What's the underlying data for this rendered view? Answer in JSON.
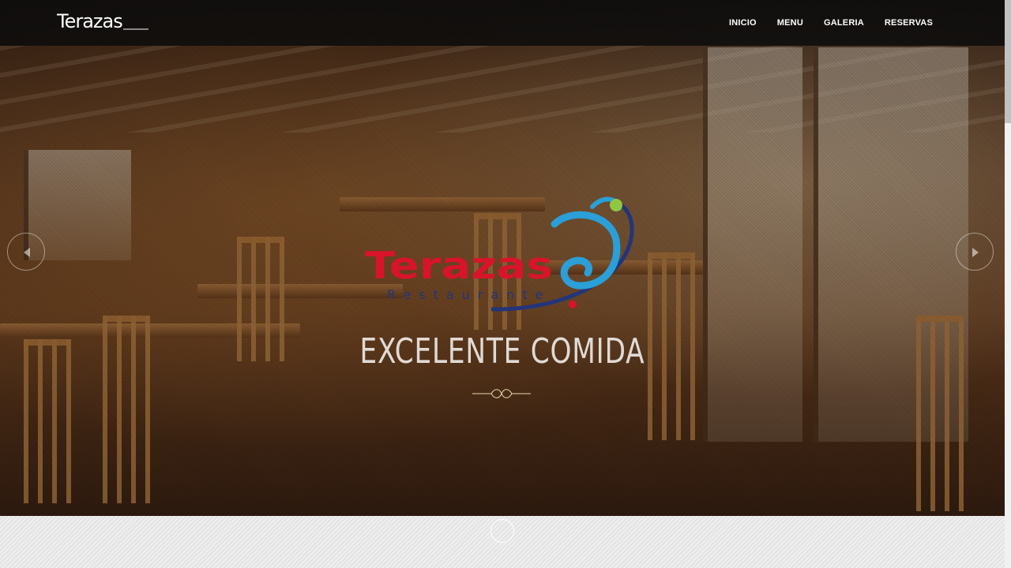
{
  "navbar": {
    "logo_text": "Terazas",
    "items": [
      {
        "label": "INICIO"
      },
      {
        "label": "MENU"
      },
      {
        "label": "GALERIA"
      },
      {
        "label": "RESERVAS"
      }
    ]
  },
  "hero": {
    "logo": {
      "name": "Terazas",
      "tagline": "Restaurante"
    },
    "headline": "EXCELENTE COMIDA"
  },
  "colors": {
    "logo_red": "#d8142a",
    "logo_blue": "#2a9fd8",
    "logo_navy": "#23357a",
    "navbar_bg": "#0c0c0c"
  },
  "icons": {
    "prev": "chevron-left-icon",
    "next": "chevron-right-icon",
    "scroll": "scroll-down-icon",
    "ornament": "ornament-divider-icon"
  }
}
